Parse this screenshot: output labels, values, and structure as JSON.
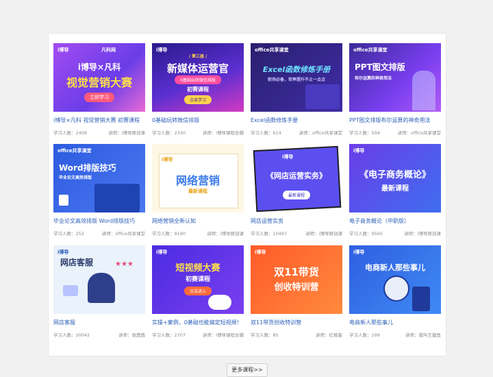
{
  "courses": [
    {
      "thumb_logo": "i博导",
      "thumb_logo2": "凡科网",
      "thumb_line1": "i博导×凡科",
      "thumb_line2": "视觉营销大赛",
      "thumb_btn": "立即学习",
      "title": "i博导×凡科 视觉营销大赛 初赛课程",
      "learners_label": "学习人数：",
      "learners": "2408",
      "teacher_label": "讲师：",
      "teacher": "i博导原创课"
    },
    {
      "thumb_logo": "i博导",
      "thumb_tag": "/ 第三届 /",
      "thumb_line1": "新媒体运营官",
      "thumb_sub": "0基础玩转微信排版",
      "thumb_line2": "初赛课程",
      "thumb_btn": "点击学习",
      "title": "0基础玩转微信排版",
      "learners_label": "学习人数：",
      "learners": "2330",
      "teacher_label": "讲师：",
      "teacher": "i博导课程合辑"
    },
    {
      "thumb_logo": "office共享课堂",
      "thumb_line1": "Excel函数修炼手册",
      "thumb_sub": "职场必备，效率提升不止一点点",
      "title": "Excel函数修炼手册",
      "learners_label": "学习人数：",
      "learners": "614",
      "teacher_label": "讲师：",
      "teacher": "office共享课堂"
    },
    {
      "thumb_logo": "office共享课堂",
      "thumb_line1": "PPT图文排版",
      "thumb_sub": "布尔运算的神奇用法",
      "title": "PPT图文排版布尔运算的神奇用法",
      "learners_label": "学习人数：",
      "learners": "504",
      "teacher_label": "讲师：",
      "teacher": "office共享课堂"
    },
    {
      "thumb_logo": "office共享课堂",
      "thumb_line1": "Word排版技巧",
      "thumb_sub": "毕业论文高效排版",
      "title": "毕业论文高效排版 Word排版技巧",
      "learners_label": "学习人数：",
      "learners": "252",
      "teacher_label": "讲师：",
      "teacher": "office共享课堂"
    },
    {
      "thumb_logo": "i博导",
      "thumb_line1": "网络营销",
      "thumb_sub": "最新课程",
      "title": "网络营销全新认知",
      "learners_label": "学习人数：",
      "learners": "9190",
      "teacher_label": "讲师：",
      "teacher": "i博导原创课"
    },
    {
      "thumb_logo": "i博导",
      "thumb_line1": "《网店运营实务》",
      "thumb_btn": "最新课程",
      "title": "网店运营实务",
      "learners_label": "学习人数：",
      "learners": "10497",
      "teacher_label": "讲师：",
      "teacher": "i博导原创课"
    },
    {
      "thumb_logo": "i博导",
      "thumb_line1": "《电子商务概论》",
      "thumb_sub": "最新课程",
      "title": "电子商务概论（中职版）",
      "learners_label": "学习人数：",
      "learners": "9565",
      "teacher_label": "讲师：",
      "teacher": "i博导原创课"
    },
    {
      "thumb_logo": "i博导",
      "thumb_line1": "网店客服",
      "title": "网店客服",
      "learners_label": "学习人数：",
      "learners": "20042",
      "teacher_label": "讲师：",
      "teacher": "张茜茜"
    },
    {
      "thumb_logo": "i博导",
      "thumb_line1": "短视频大赛",
      "thumb_line2": "初赛课程",
      "thumb_btn": "点击进入",
      "title": "实操+案例，0基础也能搞定短视频！",
      "learners_label": "学习人数：",
      "learners": "2707",
      "teacher_label": "讲师：",
      "teacher": "i博导课程合辑"
    },
    {
      "thumb_logo": "i博导",
      "thumb_line1": "双11带货",
      "thumb_line2": "创收特训营",
      "title": "双11带货创收特训营",
      "learners_label": "学习人数：",
      "learners": "85",
      "teacher_label": "讲师：",
      "teacher": "红桃客"
    },
    {
      "thumb_logo": "i博导",
      "thumb_line1": "电商新人那些事儿",
      "title": "电商新人那些事儿",
      "learners_label": "学习人数：",
      "learners": "299",
      "teacher_label": "讲师：",
      "teacher": "我叫王摸鱼"
    }
  ],
  "more_button": "更多课程>>",
  "colors": {
    "title_blue": "#2b5fb8",
    "meta_gray": "#888888",
    "panel_bg": "#ffffff",
    "page_bg": "#f1f1f1"
  }
}
